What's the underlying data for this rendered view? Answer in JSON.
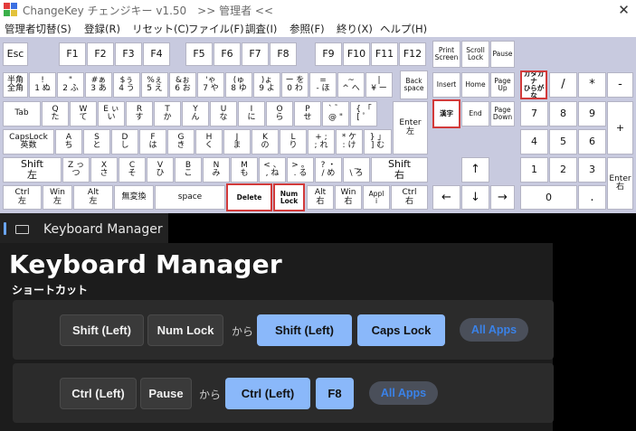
{
  "window": {
    "title": "ChangeKey チェンジキー v1.50　>> 管理者 <<",
    "close_label": "✕"
  },
  "menu": [
    "管理者切替(S)",
    "登録(R)",
    "リセット(C)",
    "ファイル(F)",
    "調査(I)",
    "参照(F)",
    "終り(X)",
    "ヘルプ(H)"
  ],
  "keyboard": {
    "highlighted_keys": [
      "カタカナ ひらがな",
      "漢字",
      "Delete",
      "Num Lock"
    ],
    "rows": {
      "function": [
        "Esc",
        "F1",
        "F2",
        "F3",
        "F4",
        "F5",
        "F6",
        "F7",
        "F8",
        "F9",
        "F10",
        "F11",
        "F12",
        "Print Screen",
        "Scroll Lock",
        "Pause"
      ],
      "number": [
        "半角\n全角",
        "!\n1 ぬ",
        "\"\n2 ふ",
        "#ぁ\n3 あ",
        "$ぅ\n4 う",
        "%ぇ\n5 え",
        "&ぉ\n6 お",
        "'ゃ\n7 や",
        "(ゅ\n8 ゆ",
        ")ょ\n9 よ",
        "ー を\n0 わ",
        "=\n- ほ",
        "~\n^ へ",
        "|\n¥ ー",
        "Back\nspace",
        "Insert",
        "Home",
        "Page\nUp",
        "カタカナ\nひらがな",
        "/",
        "*",
        "-"
      ],
      "qwerty": [
        "Tab",
        "Q\nた",
        "W\nて",
        "E ぃ\nい",
        "R\nす",
        "T\nか",
        "Y\nん",
        "U\nな",
        "I\nに",
        "O\nら",
        "P\nせ",
        "` ゛\n@ \"",
        "{ 「\n[ ゜",
        "Enter\n左",
        "漢字",
        "End",
        "Page\nDown",
        "7",
        "8",
        "9",
        "+"
      ],
      "asdf": [
        "CapsLock\n英数",
        "A\nち",
        "S\nと",
        "D\nし",
        "F\nは",
        "G\nき",
        "H\nく",
        "J\nま",
        "K\nの",
        "L\nり",
        "+ ;\n; れ",
        "* ケ\n: け",
        "} 」\n] む",
        "4",
        "5",
        "6"
      ],
      "zxcv": [
        "Shift\n左",
        "Z っ\nつ",
        "X\nさ",
        "C\nそ",
        "V\nひ",
        "B\nこ",
        "N\nみ",
        "M\nも",
        "< 、\n, ね",
        "> 。\n. る",
        "? ・\n/ め",
        "_\n\\ ろ",
        "Shift\n右",
        "↑",
        "1",
        "2",
        "3",
        "Enter\n右"
      ],
      "bottom": [
        "Ctrl\n左",
        "Win\n左",
        "Alt\n左",
        "無変換",
        "space",
        "Delete",
        "Num\nLock",
        "Alt\n右",
        "Win\n右",
        "Appl\ni",
        "Ctrl\n右",
        "←",
        "↓",
        "→",
        "0",
        "."
      ]
    }
  },
  "manager": {
    "tab_label": "Keyboard Manager",
    "title": "Keyboard Manager",
    "subtitle": "ショートカット",
    "shortcuts": [
      {
        "from": [
          "Shift (Left)",
          "Num Lock"
        ],
        "connector": "から",
        "to": [
          "Shift (Left)",
          "Caps Lock"
        ],
        "scope": "All Apps"
      },
      {
        "from": [
          "Ctrl (Left)",
          "Pause"
        ],
        "connector": "から",
        "to": [
          "Ctrl (Left)",
          "F8"
        ],
        "scope": "All Apps"
      }
    ]
  },
  "colors": {
    "keyboard_bg": "#c8cadf",
    "highlight": "#d23a3a",
    "accent": "#8ab8fa",
    "pill_text": "#3a82e8"
  }
}
